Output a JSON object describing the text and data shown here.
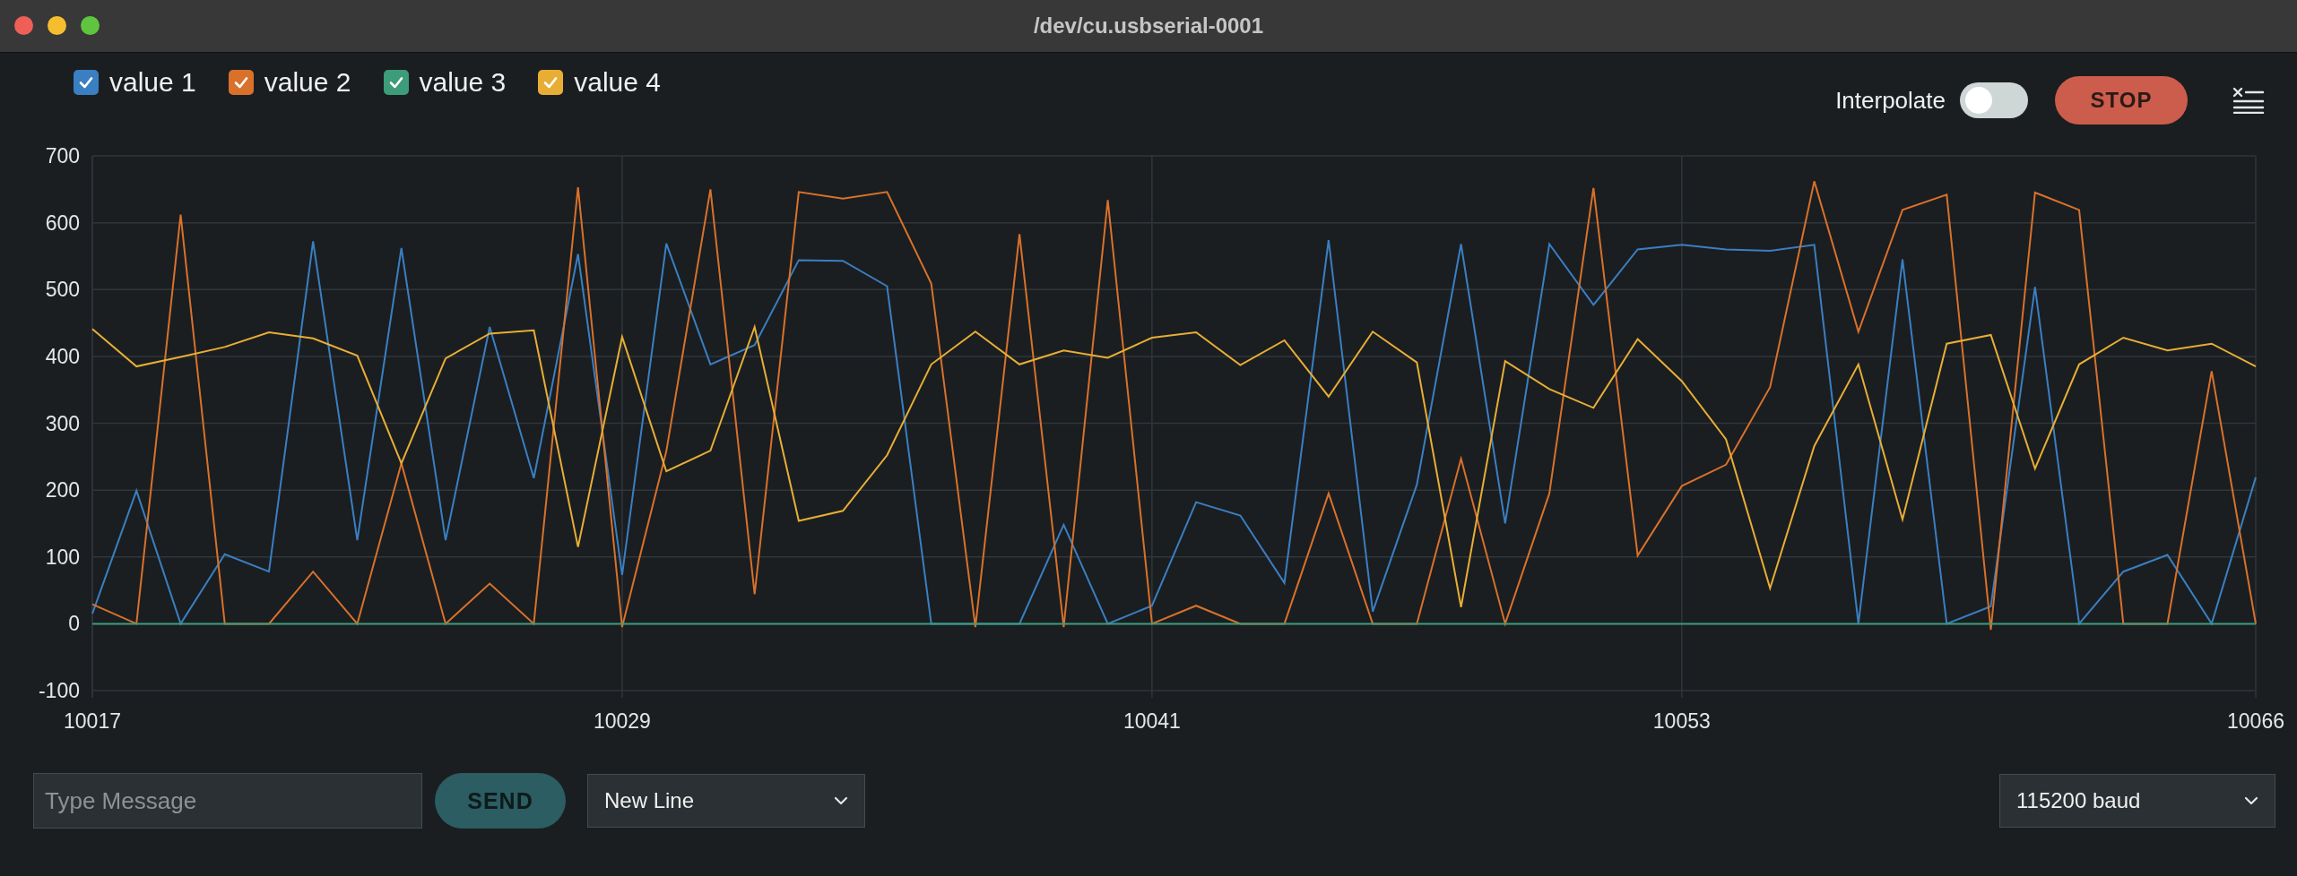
{
  "window": {
    "title": "/dev/cu.usbserial-0001"
  },
  "legend": [
    {
      "checked": true
    },
    {
      "checked": true
    },
    {
      "checked": true
    },
    {
      "checked": true
    }
  ],
  "toolbar": {
    "interpolate": {
      "label": "Interpolate",
      "on": false
    },
    "stop_button": "STOP"
  },
  "chart": {
    "chart_data": {
      "type": "line",
      "grid": true,
      "xlim": [
        10017,
        10066
      ],
      "ylim": [
        -100,
        700
      ],
      "xticks": [
        10017,
        10029,
        10041,
        10053,
        10066
      ],
      "yticks": [
        -100,
        0,
        100,
        200,
        300,
        400,
        500,
        600,
        700
      ],
      "x": [
        10017,
        10018,
        10019,
        10020,
        10021,
        10022,
        10023,
        10024,
        10025,
        10026,
        10027,
        10028,
        10029,
        10030,
        10031,
        10032,
        10033,
        10034,
        10035,
        10036,
        10037,
        10038,
        10039,
        10040,
        10041,
        10042,
        10043,
        10044,
        10045,
        10046,
        10047,
        10048,
        10049,
        10050,
        10051,
        10052,
        10053,
        10054,
        10055,
        10056,
        10057,
        10058,
        10059,
        10060,
        10061,
        10062,
        10063,
        10064,
        10065,
        10066
      ],
      "series": [
        {
          "name": "value 1",
          "color": "#3a7fc1",
          "values": [
            15,
            199,
            0,
            104,
            78,
            572,
            125,
            562,
            125,
            444,
            218,
            553,
            73,
            569,
            388,
            417,
            544,
            543,
            505,
            0,
            0,
            0,
            148,
            0,
            27,
            182,
            162,
            61,
            574,
            18,
            208,
            568,
            150,
            568,
            477,
            560,
            567,
            560,
            558,
            567,
            0,
            545,
            0,
            26,
            504,
            0,
            78,
            103,
            0,
            219
          ]
        },
        {
          "name": "value 2",
          "color": "#d9712b",
          "values": [
            29,
            0,
            612,
            0,
            0,
            78,
            0,
            240,
            0,
            60,
            0,
            653,
            -5,
            258,
            650,
            44,
            646,
            636,
            646,
            509,
            -5,
            583,
            -5,
            634,
            0,
            27,
            0,
            0,
            195,
            0,
            0,
            247,
            0,
            195,
            652,
            102,
            206,
            238,
            354,
            662,
            437,
            619,
            642,
            -9,
            645,
            619,
            0,
            0,
            378,
            0
          ]
        },
        {
          "name": "value 3",
          "color": "#3d9c7a",
          "values": [
            0,
            0,
            0,
            0,
            0,
            0,
            0,
            0,
            0,
            0,
            0,
            0,
            0,
            0,
            0,
            0,
            0,
            0,
            0,
            0,
            0,
            0,
            0,
            0,
            0,
            0,
            0,
            0,
            0,
            0,
            0,
            0,
            0,
            0,
            0,
            0,
            0,
            0,
            0,
            0,
            0,
            0,
            0,
            0,
            0,
            0,
            0,
            0,
            0,
            0
          ]
        },
        {
          "name": "value 4",
          "color": "#e8ae34",
          "values": [
            441,
            385,
            399,
            414,
            436,
            427,
            401,
            240,
            397,
            434,
            439,
            115,
            429,
            228,
            259,
            444,
            154,
            169,
            252,
            388,
            437,
            388,
            409,
            398,
            428,
            436,
            387,
            424,
            340,
            437,
            391,
            25,
            393,
            351,
            323,
            426,
            363,
            276,
            53,
            266,
            388,
            156,
            419,
            432,
            232,
            388,
            428,
            409,
            419,
            385
          ]
        }
      ]
    }
  },
  "footer": {
    "message_field": {
      "placeholder": "Type Message"
    },
    "send_button": "SEND",
    "line_ending": "New Line",
    "baud_rate": "115200 baud"
  }
}
